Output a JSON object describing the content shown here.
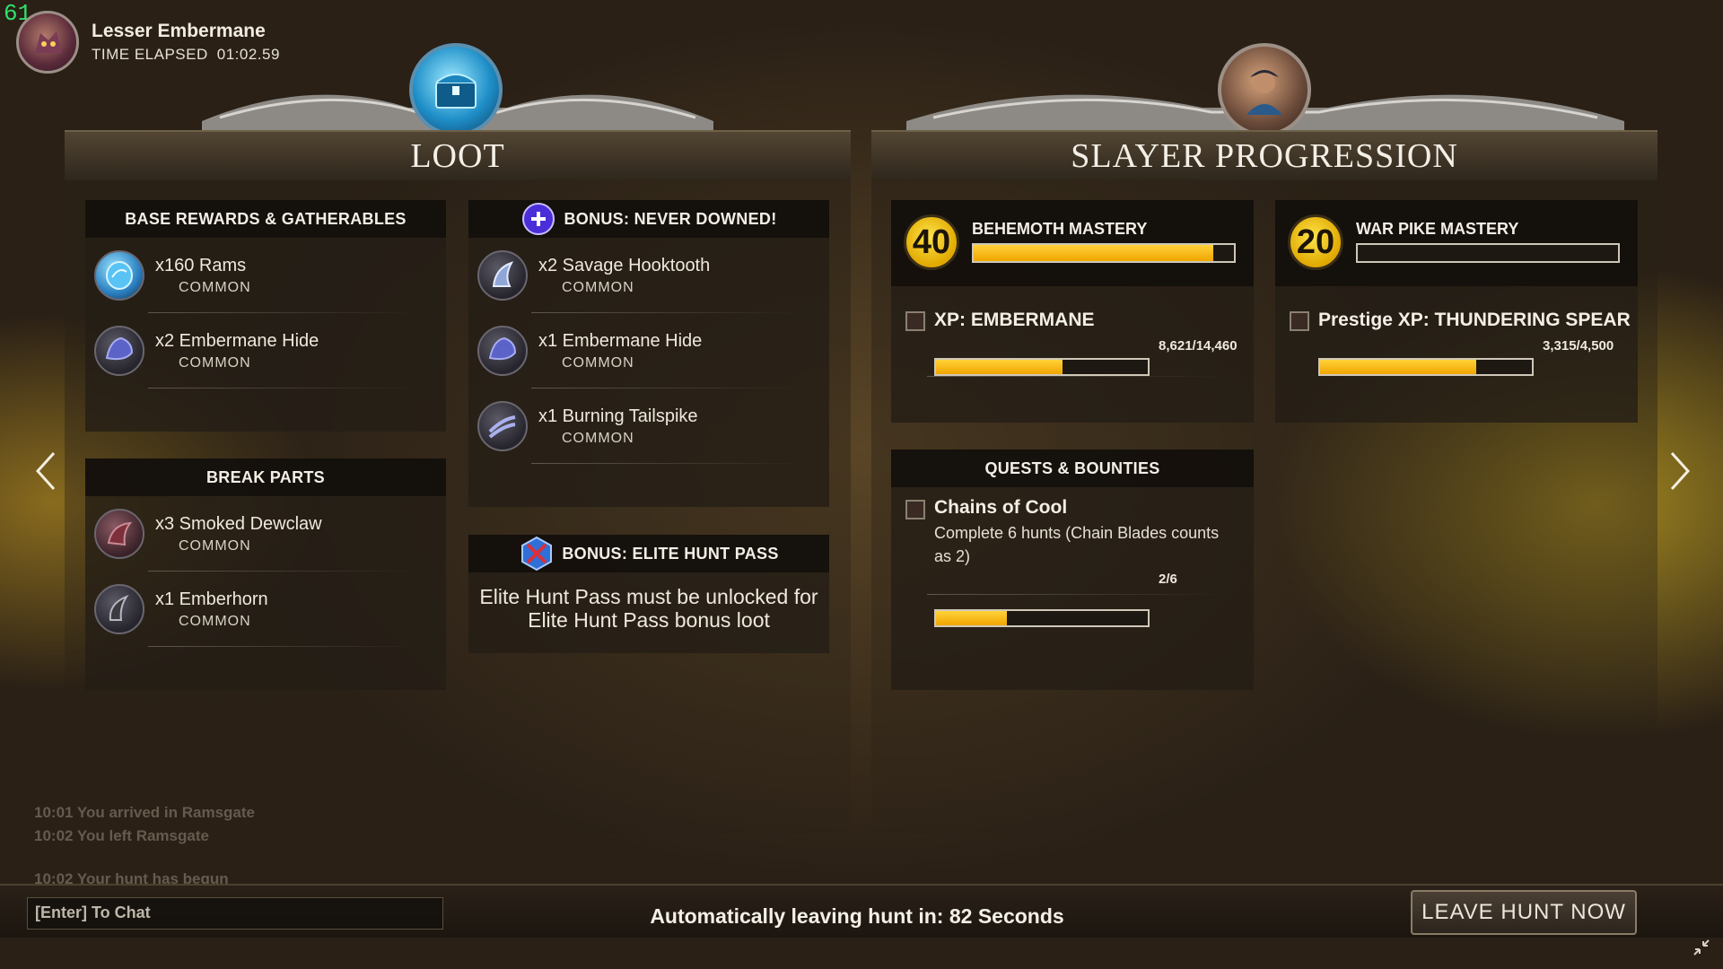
{
  "hud": {
    "fps": "61",
    "monster_name": "Lesser Embermane",
    "time_elapsed_label": "TIME ELAPSED",
    "time_elapsed_value": "01:02.59"
  },
  "loot": {
    "title": "LOOT",
    "base_rewards": {
      "header": "BASE REWARDS & GATHERABLES",
      "items": [
        {
          "qty_name": "x160 Rams",
          "rarity": "COMMON",
          "icon": "ram-gem-icon"
        },
        {
          "qty_name": "x2 Embermane Hide",
          "rarity": "COMMON",
          "icon": "hide-icon"
        }
      ]
    },
    "break_parts": {
      "header": "BREAK PARTS",
      "items": [
        {
          "qty_name": "x3 Smoked Dewclaw",
          "rarity": "COMMON",
          "icon": "dewclaw-icon"
        },
        {
          "qty_name": "x1 Emberhorn",
          "rarity": "COMMON",
          "icon": "horn-icon"
        }
      ]
    },
    "bonus_never_downed": {
      "header": "BONUS: NEVER DOWNED!",
      "items": [
        {
          "qty_name": "x2 Savage Hooktooth",
          "rarity": "COMMON",
          "icon": "hooktooth-icon"
        },
        {
          "qty_name": "x1 Embermane Hide",
          "rarity": "COMMON",
          "icon": "hide-icon"
        },
        {
          "qty_name": "x1 Burning Tailspike",
          "rarity": "COMMON",
          "icon": "tailspike-icon"
        }
      ]
    },
    "bonus_elite": {
      "header": "BONUS: ELITE HUNT PASS",
      "message": "Elite Hunt Pass must be unlocked for Elite Hunt Pass bonus loot"
    }
  },
  "progression": {
    "title": "SLAYER PROGRESSION",
    "behemoth_mastery": {
      "label": "BEHEMOTH MASTERY",
      "level": "40",
      "progress": 0.92,
      "xp_label": "XP: EMBERMANE",
      "xp_text": "8,621/14,460",
      "xp_progress": 0.596
    },
    "weapon_mastery": {
      "label": "WAR PIKE MASTERY",
      "level": "20",
      "progress": 0.0,
      "xp_label": "Prestige XP: THUNDERING SPEAR",
      "xp_text": "3,315/4,500",
      "xp_progress": 0.737
    },
    "quests": {
      "header": "QUESTS & BOUNTIES",
      "items": [
        {
          "title": "Chains of Cool",
          "description": "Complete 6 hunts (Chain Blades counts as 2)",
          "progress_text": "2/6",
          "progress": 0.333
        }
      ]
    }
  },
  "chat": {
    "log": [
      "10:01 You arrived in Ramsgate",
      "10:02 You left Ramsgate",
      "10:02 Your hunt has begun"
    ],
    "input_placeholder": "[Enter] To Chat"
  },
  "footer": {
    "auto_leave": "Automatically leaving hunt in: 82 Seconds",
    "leave_button": "LEAVE HUNT NOW"
  },
  "colors": {
    "progress_fill": "#f5b800",
    "level_badge": "#ffd21a",
    "accent_gold": "#e8c25a"
  }
}
